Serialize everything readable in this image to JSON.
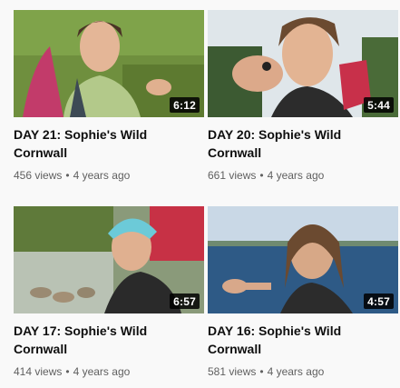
{
  "videos": [
    {
      "title": "DAY 21: Sophie's Wild Cornwall",
      "duration": "6:12",
      "views": "456 views",
      "dot": "•",
      "age": "4 years ago"
    },
    {
      "title": "DAY 20: Sophie's Wild Cornwall",
      "duration": "5:44",
      "views": "661 views",
      "dot": "•",
      "age": "4 years ago"
    },
    {
      "title": "DAY 17: Sophie's Wild Cornwall",
      "duration": "6:57",
      "views": "414 views",
      "dot": "•",
      "age": "4 years ago"
    },
    {
      "title": "DAY 16: Sophie's Wild Cornwall",
      "duration": "4:57",
      "views": "581 views",
      "dot": "•",
      "age": "4 years ago"
    }
  ]
}
